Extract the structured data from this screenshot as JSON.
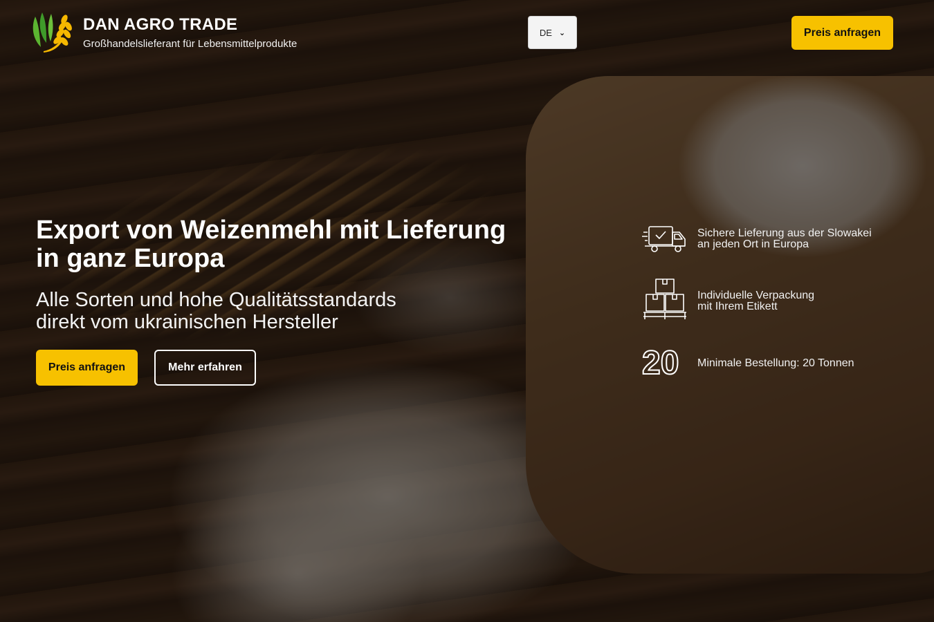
{
  "header": {
    "brand_title": "DAN AGRO TRADE",
    "brand_subtitle": "Großhandelslieferant für Lebensmittelprodukte",
    "language": "DE",
    "cta_label": "Preis anfragen"
  },
  "hero": {
    "title_line1": "Export von Weizenmehl mit Lieferung",
    "title_line2": "in ganz Europa",
    "subtitle_line1": "Alle Sorten und hohe Qualitätsstandards",
    "subtitle_line2": "direkt vom ukrainischen Hersteller",
    "primary_cta": "Preis anfragen",
    "secondary_cta": "Mehr erfahren"
  },
  "features": [
    {
      "icon": "delivery-truck-icon",
      "line1": "Sichere Lieferung aus der Slowakei",
      "line2": "an jeden Ort in Europa"
    },
    {
      "icon": "packaging-boxes-icon",
      "line1": "Individuelle Verpackung",
      "line2": "mit Ihrem Etikett"
    },
    {
      "icon": "number-20-icon",
      "number": "20",
      "line1": "Minimale Bestellung: 20 Tonnen"
    }
  ],
  "colors": {
    "accent": "#f7c100",
    "logo_green": "#5cb531",
    "logo_yellow": "#f6b800"
  }
}
